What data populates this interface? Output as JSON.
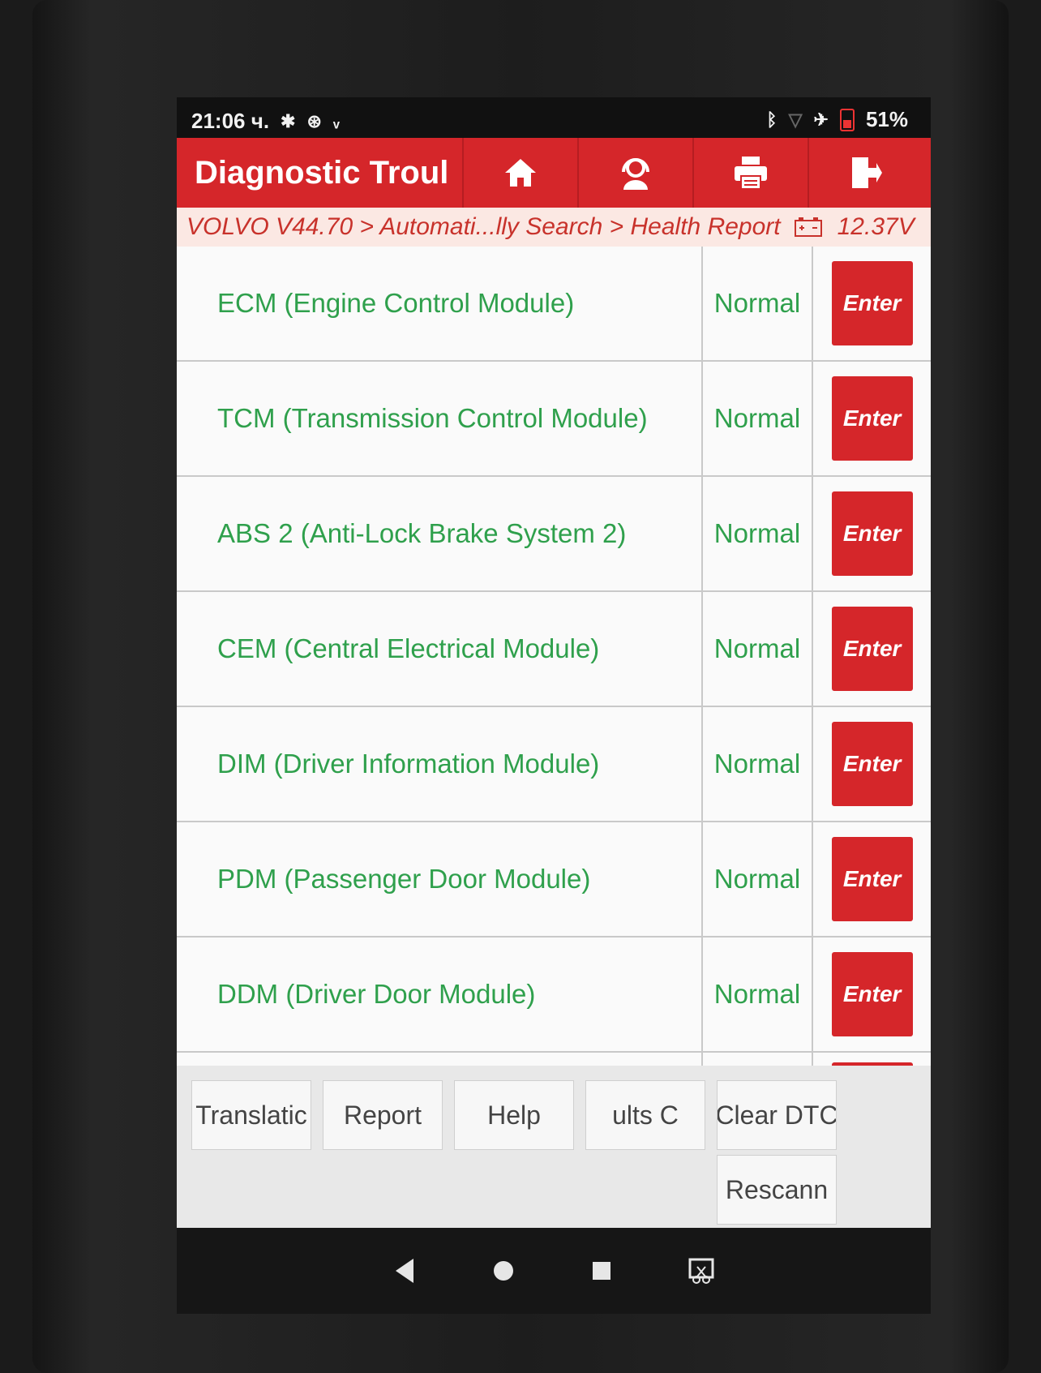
{
  "status_bar": {
    "time": "21:06 ч.",
    "battery": "51%"
  },
  "header": {
    "title": "Diagnostic Troul"
  },
  "breadcrumb": {
    "path": "VOLVO V44.70 > Automati...lly Search > Health Report",
    "voltage": "12.37V"
  },
  "modules": [
    {
      "name": "ECM (Engine Control Module)",
      "status": "Normal",
      "action": "Enter"
    },
    {
      "name": "TCM (Transmission Control Module)",
      "status": "Normal",
      "action": "Enter"
    },
    {
      "name": "ABS 2 (Anti-Lock Brake System 2)",
      "status": "Normal",
      "action": "Enter"
    },
    {
      "name": "CEM (Central Electrical Module)",
      "status": "Normal",
      "action": "Enter"
    },
    {
      "name": "DIM (Driver Information Module)",
      "status": "Normal",
      "action": "Enter"
    },
    {
      "name": "PDM (Passenger Door Module)",
      "status": "Normal",
      "action": "Enter"
    },
    {
      "name": "DDM (Driver Door Module)",
      "status": "Normal",
      "action": "Enter"
    }
  ],
  "footer_buttons": {
    "translation": "Translatic",
    "report": "Report",
    "help": "Help",
    "results": "ults     C",
    "clear_dtc": "Clear DTC",
    "rescan": "Rescann"
  },
  "colors": {
    "brand_red": "#d5262a",
    "status_green": "#2fa04c",
    "breadcrumb_bg": "#fbe8e3"
  },
  "icons": {
    "header": [
      "home-icon",
      "support-agent-icon",
      "print-icon",
      "exit-icon"
    ],
    "status": [
      "settings-icon",
      "bluetooth-icon",
      "airplane-icon",
      "battery-icon"
    ],
    "nav": [
      "back-icon",
      "home-nav-icon",
      "recents-icon",
      "screenshot-icon"
    ]
  }
}
